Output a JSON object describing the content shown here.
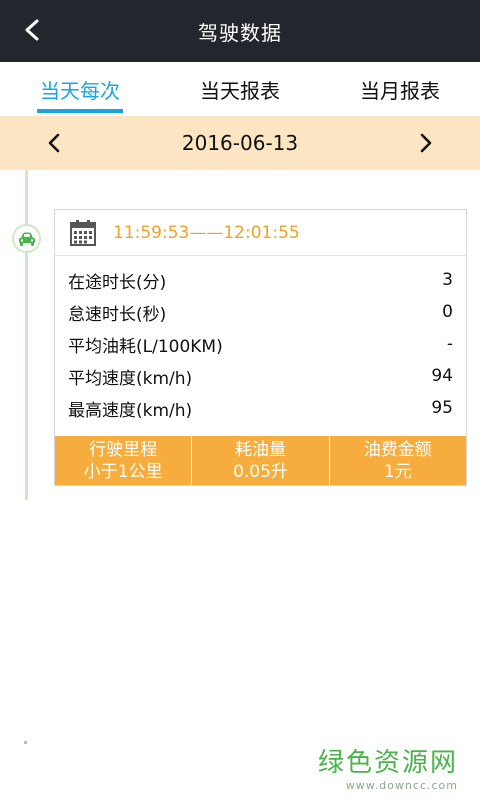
{
  "header": {
    "title": "驾驶数据"
  },
  "tabs": [
    {
      "label": "当天每次",
      "active": true
    },
    {
      "label": "当天报表",
      "active": false
    },
    {
      "label": "当月报表",
      "active": false
    }
  ],
  "date_bar": {
    "date": "2016-06-13",
    "prev": "<",
    "next": ">"
  },
  "trip": {
    "time_range": "11:59:53——12:01:55",
    "rows": [
      {
        "label": "在途时长(分)",
        "value": "3"
      },
      {
        "label": "怠速时长(秒)",
        "value": "0"
      },
      {
        "label": "平均油耗(L/100KM)",
        "value": "-"
      },
      {
        "label": "平均速度(km/h)",
        "value": "94"
      },
      {
        "label": "最高速度(km/h)",
        "value": "95"
      }
    ],
    "summary": [
      {
        "title": "行驶里程",
        "value": "小于1公里"
      },
      {
        "title": "耗油量",
        "value": "0.05升"
      },
      {
        "title": "油费金额",
        "value": "1元"
      }
    ]
  },
  "colors": {
    "header_bg": "#23262d",
    "accent_blue": "#19a6e0",
    "date_bar_bg": "#fbe5c3",
    "time_orange": "#f0a32b",
    "footer_orange": "#f6ad3d",
    "timeline_green": "#4bb34b"
  },
  "watermark": {
    "main": "绿色资源网",
    "sub": "www.downcc.com"
  }
}
